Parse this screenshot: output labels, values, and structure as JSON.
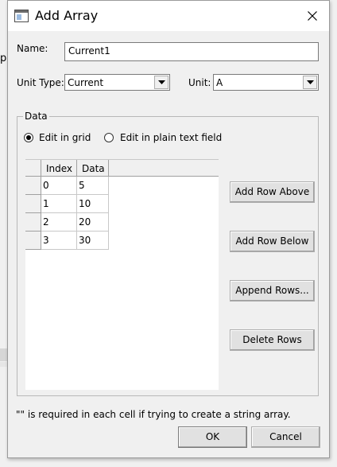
{
  "background": {
    "partial_letter": "p"
  },
  "window": {
    "title": "Add Array"
  },
  "name_field": {
    "label": "Name:",
    "value": "Current1"
  },
  "unit_type": {
    "label": "Unit Type:",
    "value": "Current"
  },
  "unit": {
    "label": "Unit:",
    "value": "A"
  },
  "data_group": {
    "title": "Data",
    "radio_grid_label": "Edit in grid",
    "radio_text_label": "Edit in plain text field",
    "selected_mode": "grid"
  },
  "grid": {
    "columns": [
      "Index",
      "Data"
    ],
    "rows": [
      {
        "index": "0",
        "data": "5"
      },
      {
        "index": "1",
        "data": "10"
      },
      {
        "index": "2",
        "data": "20"
      },
      {
        "index": "3",
        "data": "30"
      }
    ]
  },
  "buttons": {
    "add_above": "Add Row Above",
    "add_below": "Add Row Below",
    "append": "Append Rows...",
    "delete": "Delete Rows",
    "ok": "OK",
    "cancel": "Cancel"
  },
  "note": "\"\" is required in each cell if trying to create a string array.",
  "icons": {
    "app": "window-icon",
    "close": "close-icon",
    "dropdown": "chevron-down-icon"
  },
  "colors": {
    "dialog_bg": "#f0f0f0",
    "titlebar_bg": "#ffffff",
    "button_bg": "#e1e1e1"
  }
}
